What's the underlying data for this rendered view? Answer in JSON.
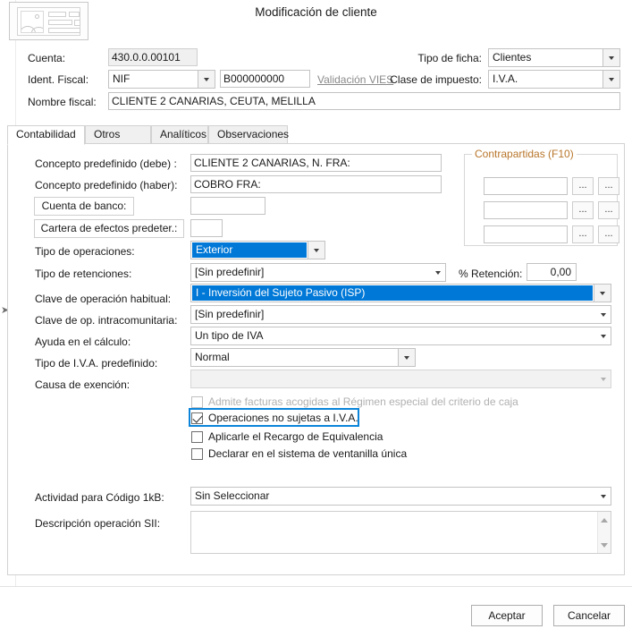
{
  "window": {
    "title": "Modificación de cliente",
    "icon": "form-record-icon"
  },
  "header": {
    "cuenta_label": "Cuenta:",
    "cuenta_value": "430.0.0.00101",
    "ident_fiscal_label": "Ident. Fiscal:",
    "ident_fiscal_type": "NIF",
    "ident_fiscal_value": "B000000000",
    "vies_link": "Validación VIES",
    "nombre_fiscal_label": "Nombre fiscal:",
    "nombre_fiscal_value": "CLIENTE 2 CANARIAS, CEUTA, MELILLA",
    "tipo_ficha_label": "Tipo de ficha:",
    "tipo_ficha_value": "Clientes",
    "clase_impuesto_label": "Clase de impuesto:",
    "clase_impuesto_value": "I.V.A."
  },
  "tabs": [
    {
      "label": "Contabilidad",
      "active": true
    },
    {
      "label": "Otros datos",
      "active": false
    },
    {
      "label": "Analíticos",
      "active": false
    },
    {
      "label": "Observaciones",
      "active": false
    }
  ],
  "contabilidad": {
    "concepto_debe_label": "Concepto predefinido (debe) :",
    "concepto_debe_value": "CLIENTE 2 CANARIAS,  N. FRA:",
    "concepto_haber_label": "Concepto predefinido (haber):",
    "concepto_haber_value": "COBRO FRA:",
    "cuenta_banco_label": "Cuenta de banco:",
    "cuenta_banco_value": "",
    "cartera_efectos_label": "Cartera de efectos predeter.:",
    "cartera_efectos_value": "",
    "tipo_operaciones_label": "Tipo de operaciones:",
    "tipo_operaciones_value": "Exterior",
    "tipo_retenciones_label": "Tipo de retenciones:",
    "tipo_retenciones_value": "[Sin predefinir]",
    "retencion_label": "% Retención:",
    "retencion_value": "0,00",
    "clave_operacion_label": "Clave de operación habitual:",
    "clave_operacion_value": "I - Inversión del Sujeto Pasivo (ISP)",
    "clave_intracomunitaria_label": "Clave de op. intracomunitaria:",
    "clave_intracomunitaria_value": "[Sin predefinir]",
    "ayuda_calculo_label": "Ayuda en el cálculo:",
    "ayuda_calculo_value": "Un tipo de IVA",
    "tipo_iva_label": "Tipo de I.V.A. predefinido:",
    "tipo_iva_value": "Normal",
    "causa_exencion_label": "Causa de exención:",
    "causa_exencion_value": "",
    "actividad_label": "Actividad para Código 1kB:",
    "actividad_value": "Sin Seleccionar",
    "descripcion_sii_label": "Descripción operación SII:",
    "descripcion_sii_value": ""
  },
  "contrapartidas": {
    "title": "Contrapartidas (F10)",
    "rows": [
      {
        "value": "",
        "btn1": "...",
        "btn2": "..."
      },
      {
        "value": "",
        "btn1": "...",
        "btn2": "..."
      },
      {
        "value": "",
        "btn1": "...",
        "btn2": "..."
      }
    ]
  },
  "checkboxes": [
    {
      "label": "Admite facturas acogidas al Régimen especial del criterio de caja",
      "checked": false,
      "disabled": true,
      "focused": false
    },
    {
      "label": "Operaciones no sujetas a I.V.A.",
      "checked": true,
      "disabled": false,
      "focused": true
    },
    {
      "label": "Aplicarle el Recargo de Equivalencia",
      "checked": false,
      "disabled": false,
      "focused": false
    },
    {
      "label": "Declarar en el sistema de ventanilla única",
      "checked": false,
      "disabled": false,
      "focused": false
    }
  ],
  "footer": {
    "accept_label": "Aceptar",
    "cancel_label": "Cancelar"
  },
  "colors": {
    "accent": "#0078d7",
    "focus_border": "#0b84d9",
    "group_title": "#b8762b",
    "link": "#8a8a8a"
  }
}
